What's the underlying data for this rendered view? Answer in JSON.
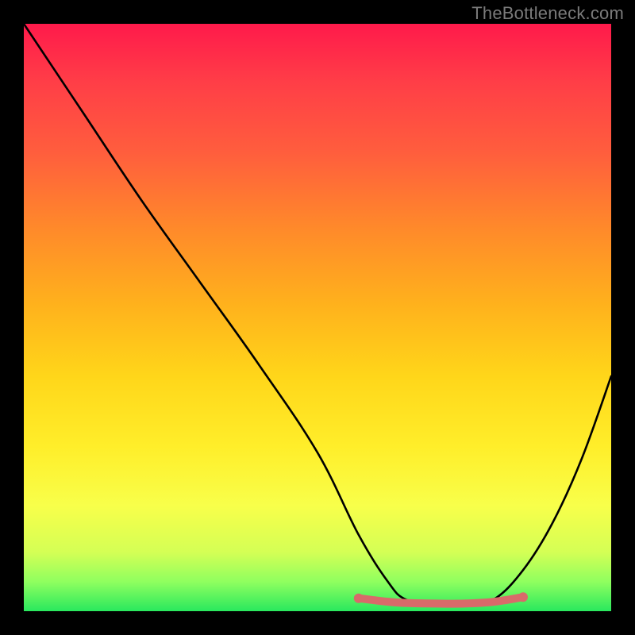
{
  "attribution": "TheBottleneck.com",
  "chart_data": {
    "type": "line",
    "title": "",
    "xlabel": "",
    "ylabel": "",
    "xlim": [
      0,
      100
    ],
    "ylim": [
      0,
      100
    ],
    "series": [
      {
        "name": "bottleneck-curve",
        "x": [
          0,
          10,
          20,
          30,
          40,
          50,
          57,
          62,
          65,
          70,
          75,
          80,
          85,
          90,
          95,
          100
        ],
        "values": [
          100,
          85,
          70,
          56,
          42,
          27,
          13,
          5,
          2,
          1,
          1,
          2,
          7,
          15,
          26,
          40
        ]
      },
      {
        "name": "optimal-range-highlight",
        "x": [
          57,
          62,
          65,
          70,
          75,
          80,
          85
        ],
        "values": [
          2.2,
          1.6,
          1.4,
          1.3,
          1.3,
          1.6,
          2.4
        ]
      }
    ],
    "colors": {
      "curve": "#000000",
      "highlight": "#d86a6a"
    }
  }
}
